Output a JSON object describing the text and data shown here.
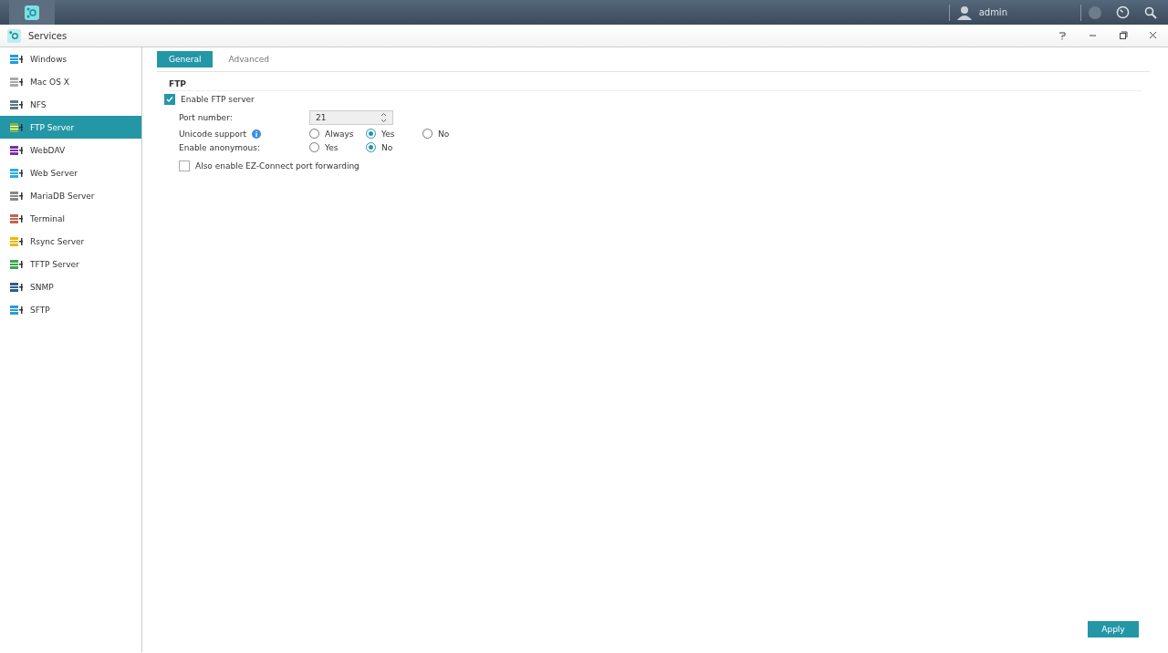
{
  "topbar": {
    "user": "admin"
  },
  "window": {
    "title": "Services"
  },
  "sidebar": {
    "items": [
      {
        "label": "Windows",
        "selected": false
      },
      {
        "label": "Mac OS X",
        "selected": false
      },
      {
        "label": "NFS",
        "selected": false
      },
      {
        "label": "FTP Server",
        "selected": true
      },
      {
        "label": "WebDAV",
        "selected": false
      },
      {
        "label": "Web Server",
        "selected": false
      },
      {
        "label": "MariaDB Server",
        "selected": false
      },
      {
        "label": "Terminal",
        "selected": false
      },
      {
        "label": "Rsync Server",
        "selected": false
      },
      {
        "label": "TFTP Server",
        "selected": false
      },
      {
        "label": "SNMP",
        "selected": false
      },
      {
        "label": "SFTP",
        "selected": false
      }
    ]
  },
  "tabs": [
    {
      "label": "General",
      "selected": true
    },
    {
      "label": "Advanced",
      "selected": false
    }
  ],
  "section": {
    "title": "FTP"
  },
  "enable_ftp": {
    "label": "Enable FTP server",
    "checked": true
  },
  "port": {
    "label": "Port number:",
    "value": "21"
  },
  "unicode": {
    "label": "Unicode support",
    "options": [
      {
        "label": "Always",
        "selected": false
      },
      {
        "label": "Yes",
        "selected": true
      },
      {
        "label": "No",
        "selected": false
      }
    ]
  },
  "anonymous": {
    "label": "Enable anonymous:",
    "options": [
      {
        "label": "Yes",
        "selected": false
      },
      {
        "label": "No",
        "selected": true
      }
    ]
  },
  "ez_connect": {
    "label": "Also enable EZ-Connect port forwarding",
    "checked": false
  },
  "apply": {
    "label": "Apply"
  }
}
